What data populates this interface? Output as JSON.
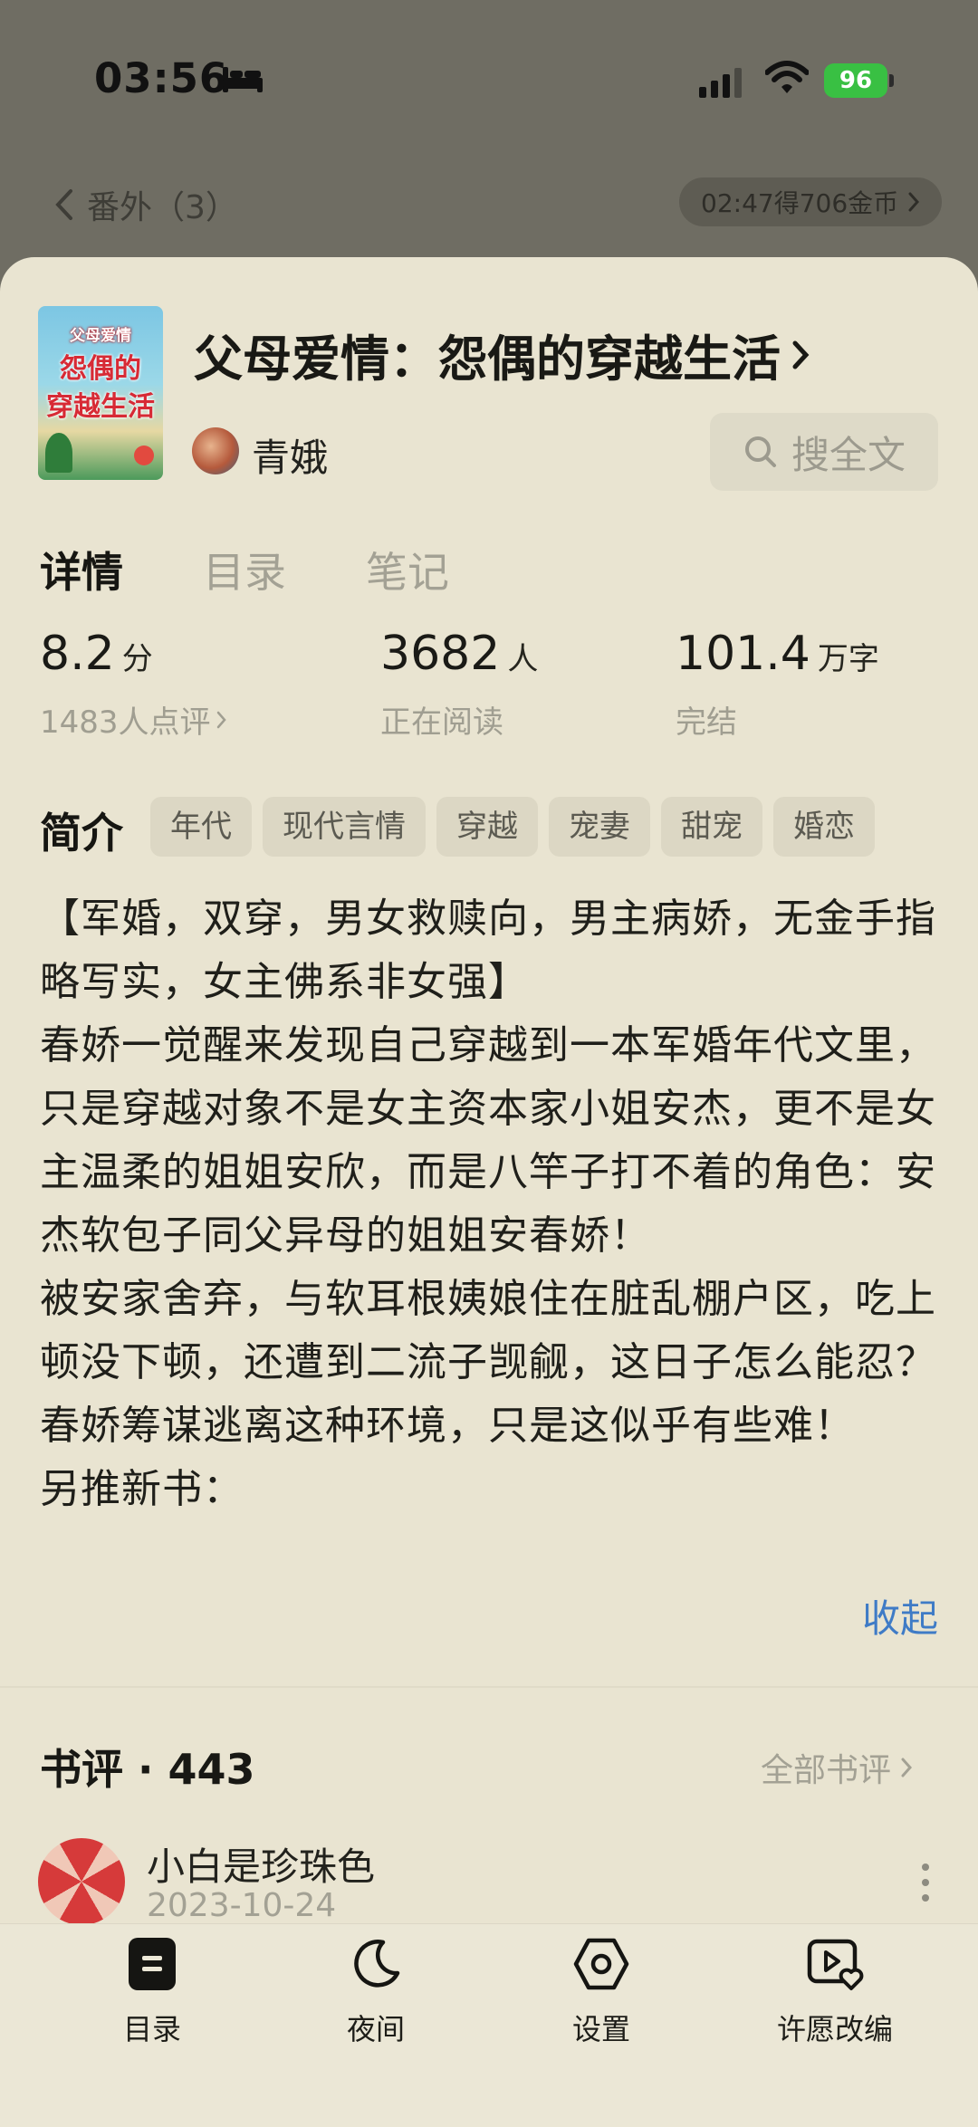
{
  "status_bar": {
    "time": "03:56",
    "battery": "96"
  },
  "top_nav": {
    "chapter": "番外（3）",
    "reward": "02:47得706金币"
  },
  "book": {
    "cover": {
      "line1": "父母爱情",
      "line2": "怨偶的",
      "line3": "穿越生活"
    },
    "title": "父母爱情：怨偶的穿越生活",
    "author": "青娥",
    "search_label": "搜全文"
  },
  "tabs": [
    {
      "label": "详情",
      "active": true
    },
    {
      "label": "目录",
      "active": false
    },
    {
      "label": "笔记",
      "active": false
    }
  ],
  "stats": [
    {
      "value": "8.2",
      "unit": "分",
      "sub": "1483人点评"
    },
    {
      "value": "3682",
      "unit": "人",
      "sub": "正在阅读"
    },
    {
      "value": "101.4",
      "unit": "万字",
      "sub": "完结"
    }
  ],
  "intro": {
    "label": "简介",
    "tags": [
      "年代",
      "现代言情",
      "穿越",
      "宠妻",
      "甜宠",
      "婚恋"
    ],
    "paragraphs": [
      "【军婚，双穿，男女救赎向，男主病娇，无金手指略写实，女主佛系非女强】",
      "春娇一觉醒来发现自己穿越到一本军婚年代文里，只是穿越对象不是女主资本家小姐安杰，更不是女主温柔的姐姐安欣，而是八竿子打不着的角色：安杰软包子同父异母的姐姐安春娇！",
      "被安家舍弃，与软耳根姨娘住在脏乱棚户区，吃上顿没下顿，还遭到二流子觊觎，这日子怎么能忍？",
      "春娇筹谋逃离这种环境，只是这似乎有些难！",
      "另推新书："
    ],
    "collapse": "收起"
  },
  "reviews": {
    "title": "书评 · 443",
    "all_link": "全部书评",
    "first": {
      "name": "小白是珍珠色",
      "date": "2023-10-24"
    }
  },
  "toolbar": [
    {
      "icon": "toc-icon",
      "label": "目录"
    },
    {
      "icon": "moon-icon",
      "label": "夜间"
    },
    {
      "icon": "settings-icon",
      "label": "设置"
    },
    {
      "icon": "wish-adapt-icon",
      "label": "许愿改编"
    }
  ],
  "colors": {
    "sheet_bg": "#e9e4d1",
    "overlay_bg": "#6f6d63",
    "link_blue": "#3f7bc6",
    "battery_green": "#39c043"
  }
}
